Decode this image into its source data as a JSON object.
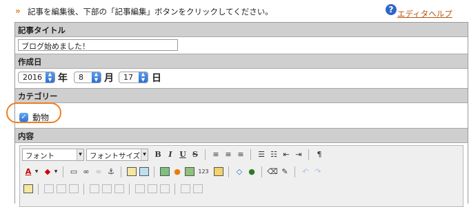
{
  "instruction": {
    "arrow": "»",
    "text": "記事を編集後、下部の「記事編集」ボタンをクリックしてください。"
  },
  "help": {
    "icon": "?",
    "link": "エディタヘルプ"
  },
  "title_section": {
    "heading": "記事タイトル",
    "value": "ブログ始めました！"
  },
  "date_section": {
    "heading": "作成日",
    "year": "2016",
    "year_unit": "年",
    "month": "8",
    "month_unit": "月",
    "day": "17",
    "day_unit": "日"
  },
  "category_section": {
    "heading": "カテゴリー",
    "checkbox_checked": true,
    "label": "動物"
  },
  "content_section": {
    "heading": "内容",
    "font_select": "フォント",
    "size_select": "フォントサイズ",
    "toolbar": {
      "bold": "B",
      "italic": "I",
      "underline": "U",
      "strike": "S"
    }
  },
  "colors": {
    "accent": "#e07a1a",
    "highlight": "#f07d1e",
    "link": "#b8540a",
    "header_bg": "#cfcfcf",
    "select_blue": "#2b6fd6"
  }
}
